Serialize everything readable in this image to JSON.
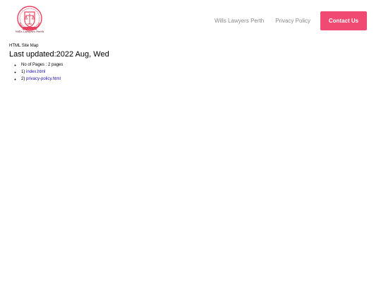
{
  "header": {
    "logo_text": "Wills Lawyers Perth",
    "nav": [
      {
        "label": "Wills Lawyers Perth"
      },
      {
        "label": "Privacy Policy"
      }
    ],
    "cta_label": "Contact Us"
  },
  "content": {
    "breadcrumb": "HTML Site Map",
    "title": "Last updated:2022 Aug, Wed",
    "pages_count": "No of Pages : 2 pages",
    "pages": [
      {
        "index": "1)",
        "link": "index.html"
      },
      {
        "index": "2)",
        "link": "privacy-policy.html"
      }
    ]
  },
  "colors": {
    "accent": "#f04a72",
    "link": "#1a0dab",
    "nav_text": "#8a8a8a",
    "logo_primary": "#e8415f"
  },
  "icons": {
    "logo": "scales-of-justice-seal-icon"
  }
}
